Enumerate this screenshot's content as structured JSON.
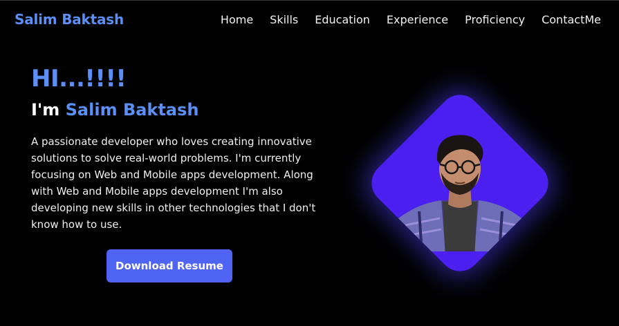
{
  "brand": "Salim Baktash",
  "nav": {
    "items": [
      {
        "label": "Home"
      },
      {
        "label": "Skills"
      },
      {
        "label": "Education"
      },
      {
        "label": "Experience"
      },
      {
        "label": "Proficiency"
      },
      {
        "label": "ContactMe"
      }
    ]
  },
  "hero": {
    "greeting": "HI...!!!!",
    "intro_prefix": "I'm ",
    "name": "Salim Baktash",
    "description": "A passionate developer who loves creating innovative solutions to solve real-world problems. I'm currently focusing on Web and Mobile apps development. Along with Web and Mobile apps development I'm also developing new skills in other technologies that I don't know how to use.",
    "resume_label": "Download Resume"
  },
  "colors": {
    "background": "#000000",
    "accent": "#5b8ff5",
    "button": "#4f64f2",
    "photo_background": "#4b1ff0"
  }
}
